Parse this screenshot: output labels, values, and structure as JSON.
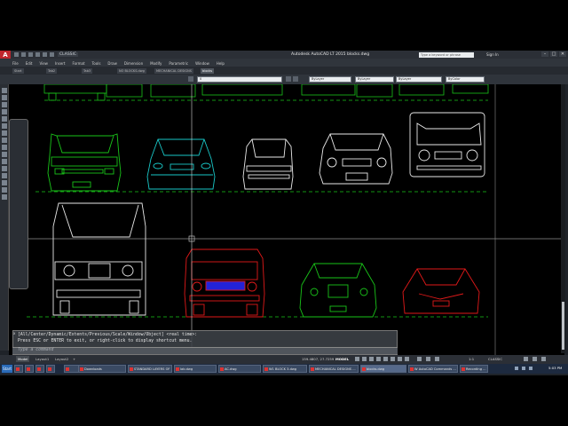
{
  "titlebar": {
    "app_letter": "A",
    "workspace": "CLASSIC",
    "title": "Autodesk AutoCAD LT 2015   blocks.dwg",
    "search_placeholder": "Type a keyword or phrase",
    "signin": "Sign In",
    "min": "–",
    "max": "□",
    "close": "✕"
  },
  "menu": [
    "File",
    "Edit",
    "View",
    "Insert",
    "Format",
    "Tools",
    "Draw",
    "Dimension",
    "Modify",
    "Parametric",
    "Window",
    "Help"
  ],
  "tabs": [
    "Start",
    "Tab2",
    "Tab3",
    "NO BLOCKS.dwg",
    "MECHANICAL DESIGNS",
    "blocks"
  ],
  "toolbar": {
    "layer_dropdown": "0",
    "color_dropdown": "ByLayer",
    "linetype_dropdown": "ByLayer",
    "lineweight_dropdown": "ByLayer",
    "plot_dropdown": "ByColor"
  },
  "command": {
    "line1": "[All/Center/Dynamic/Extents/Previous/Scale/Window/Object] <real time>:",
    "line2": "Press ESC or ENTER to exit, or right-click to display shortcut menu.",
    "input_placeholder": "Type a command",
    "close": "x"
  },
  "layout_tabs": [
    "Model",
    "Layout1",
    "Layout2",
    "+"
  ],
  "status": {
    "coords": "159.4807, 27.7259",
    "mode": "MODEL",
    "scale": "1:1",
    "workspace": "CLASSIC"
  },
  "taskbar": {
    "start": "Start",
    "items": [
      "Downloads",
      "STANDARD LAYERS OF ...",
      "lab.dwg",
      "AC.dwg",
      "W1 BLOCK 3.dwg",
      "MECHANICAL DESIGNS ...",
      "blocks.dwg",
      "W AutoCAD Commands ...",
      "Recording ..."
    ],
    "clock": "5:03 PM"
  },
  "colors": {
    "green": "#19c419",
    "cyan": "#19c6c6",
    "white": "#e8e8e8",
    "red": "#e01919",
    "blue": "#2323d8",
    "crosshair": "#d8d8d8"
  }
}
